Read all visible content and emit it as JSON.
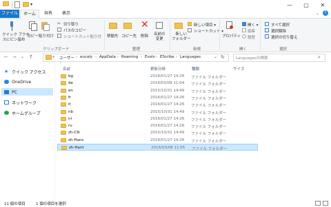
{
  "tabs": {
    "file": "ファイル",
    "home": "ホーム",
    "share": "共有",
    "view": "表示"
  },
  "ribbon": {
    "pin": "クイック アクセ\nスにピン留め",
    "copy": "コピー",
    "paste": "貼り付け",
    "cut": "切り取り",
    "copy_path": "パスのコピー",
    "paste_shortcut": "ショートカット貼り付",
    "move_to": "移動先",
    "copy_to": "コピー先",
    "delete": "削除",
    "rename": "名前の\n変更",
    "new_folder": "新しい\nフォルダー",
    "new_item": "新しい項目 ▾",
    "shortcut": "ショートカット ▾",
    "properties": "プロパティ",
    "open": "開く ▾",
    "edit": "編集",
    "history": "履歴",
    "select_all": "すべて選択",
    "select_none": "選択解除",
    "invert": "選択の切り替え",
    "groups": {
      "clipboard": "クリップボード",
      "organize": "整理",
      "new": "新規",
      "open": "開く",
      "select": "選択"
    }
  },
  "address": {
    "prefix": "«",
    "crumbs": [
      "ユーザー",
      "eucaly",
      "AppData",
      "Roaming",
      "Evolv",
      "EScribe",
      "Languages"
    ],
    "search_placeholder": "Languagesの検索"
  },
  "nav": [
    {
      "label": "クイック アクセス",
      "icon": "star-icon",
      "color": "#1e88e5"
    },
    {
      "label": "OneDrive",
      "icon": "cloud-icon",
      "color": "#1e88e5"
    },
    {
      "label": "PC",
      "icon": "computer-icon",
      "color": "#2a7bd1",
      "selected": true
    },
    {
      "label": "ネットワーク",
      "icon": "network-icon",
      "color": "#2a7bd1"
    },
    {
      "label": "ホームグループ",
      "icon": "homegroup-icon",
      "color": "#2ca34a"
    }
  ],
  "columns": {
    "name": "名前",
    "date": "更新日時",
    "type": "種類",
    "size": "サイズ"
  },
  "files": [
    {
      "name": "bg",
      "date": "2016/01/27 14:26",
      "type": "ファイル フォルダー"
    },
    {
      "name": "de",
      "date": "2016/03/08 11:04",
      "type": "ファイル フォルダー"
    },
    {
      "name": "en",
      "date": "2015/10/31 14:49",
      "type": "ファイル フォルダー"
    },
    {
      "name": "fr",
      "date": "2016/01/27 14:26",
      "type": "ファイル フォルダー"
    },
    {
      "name": "it",
      "date": "2016/01/27 14:26",
      "type": "ファイル フォルダー"
    },
    {
      "name": "nb",
      "date": "2015/10/31 14:49",
      "type": "ファイル フォルダー"
    },
    {
      "name": "nl",
      "date": "2016/01/27 14:26",
      "type": "ファイル フォルダー"
    },
    {
      "name": "ru",
      "date": "2016/01/27 14:26",
      "type": "ファイル フォルダー"
    },
    {
      "name": "zh-CN",
      "date": "2015/10/31 14:49",
      "type": "ファイル フォルダー"
    },
    {
      "name": "zh-Hans",
      "date": "2016/01/27 14:26",
      "type": "ファイル フォルダー"
    },
    {
      "name": "zh-Hant",
      "date": "2016/03/08 11:05",
      "type": "ファイル フォルダー",
      "selected": true
    }
  ],
  "status": {
    "count": "11 個の項目",
    "selected": "1 個の項目を選択"
  }
}
